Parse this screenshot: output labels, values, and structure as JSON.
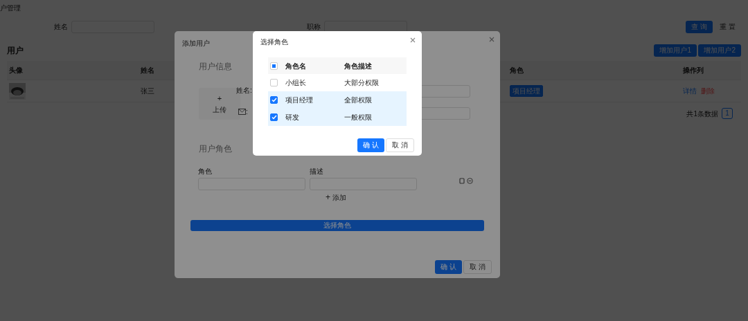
{
  "page": {
    "breadcrumb": "户管理"
  },
  "search": {
    "fields": [
      {
        "label": "姓名"
      },
      {
        "label": "职称"
      }
    ],
    "buttons": [
      {
        "label": "查 询",
        "kind": "primary"
      },
      {
        "label": "重 置",
        "kind": "text"
      }
    ]
  },
  "users": {
    "title": "用户",
    "buttons": [
      "增加用户1",
      "增加用户2"
    ],
    "columns": [
      "头像",
      "姓名",
      "角色",
      "操作列"
    ],
    "rows": [
      {
        "avatar": {
          "kind": "picture"
        },
        "name": "张三",
        "roles": [
          "项目经理"
        ],
        "actions": [
          {
            "label": "详情",
            "kind": "link"
          },
          {
            "label": "删除",
            "kind": "danger"
          }
        ]
      }
    ],
    "pagination": {
      "total": "共1条数据",
      "pages": [
        {
          "label": "1",
          "selected": true
        }
      ]
    }
  },
  "add_user_dialog": {
    "title": "添加用户",
    "info_title": "用户信息",
    "upload": {
      "icon": "+",
      "label": "上传"
    },
    "name_label": "姓名:",
    "email_label": ":",
    "role_title": "用户角色",
    "role_columns": [
      "角色",
      "描述"
    ],
    "add_label": "添加",
    "select_button": "选择角色",
    "buttons": [
      {
        "label": "确 认",
        "kind": "primary"
      },
      {
        "label": "取 消",
        "kind": "default"
      }
    ]
  },
  "select_role_dialog": {
    "title": "选择角色",
    "partially_selected": true,
    "columns": [
      "角色名",
      "角色描述"
    ],
    "rows": [
      {
        "name": "小组长",
        "description": "大部分权限",
        "selected": false
      },
      {
        "name": "项目经理",
        "description": "全部权限",
        "selected": true
      },
      {
        "name": "研发",
        "description": "一般权限",
        "selected": true
      }
    ],
    "buttons": [
      {
        "label": "确 认",
        "kind": "primary"
      },
      {
        "label": "取 消",
        "kind": "default"
      }
    ]
  }
}
